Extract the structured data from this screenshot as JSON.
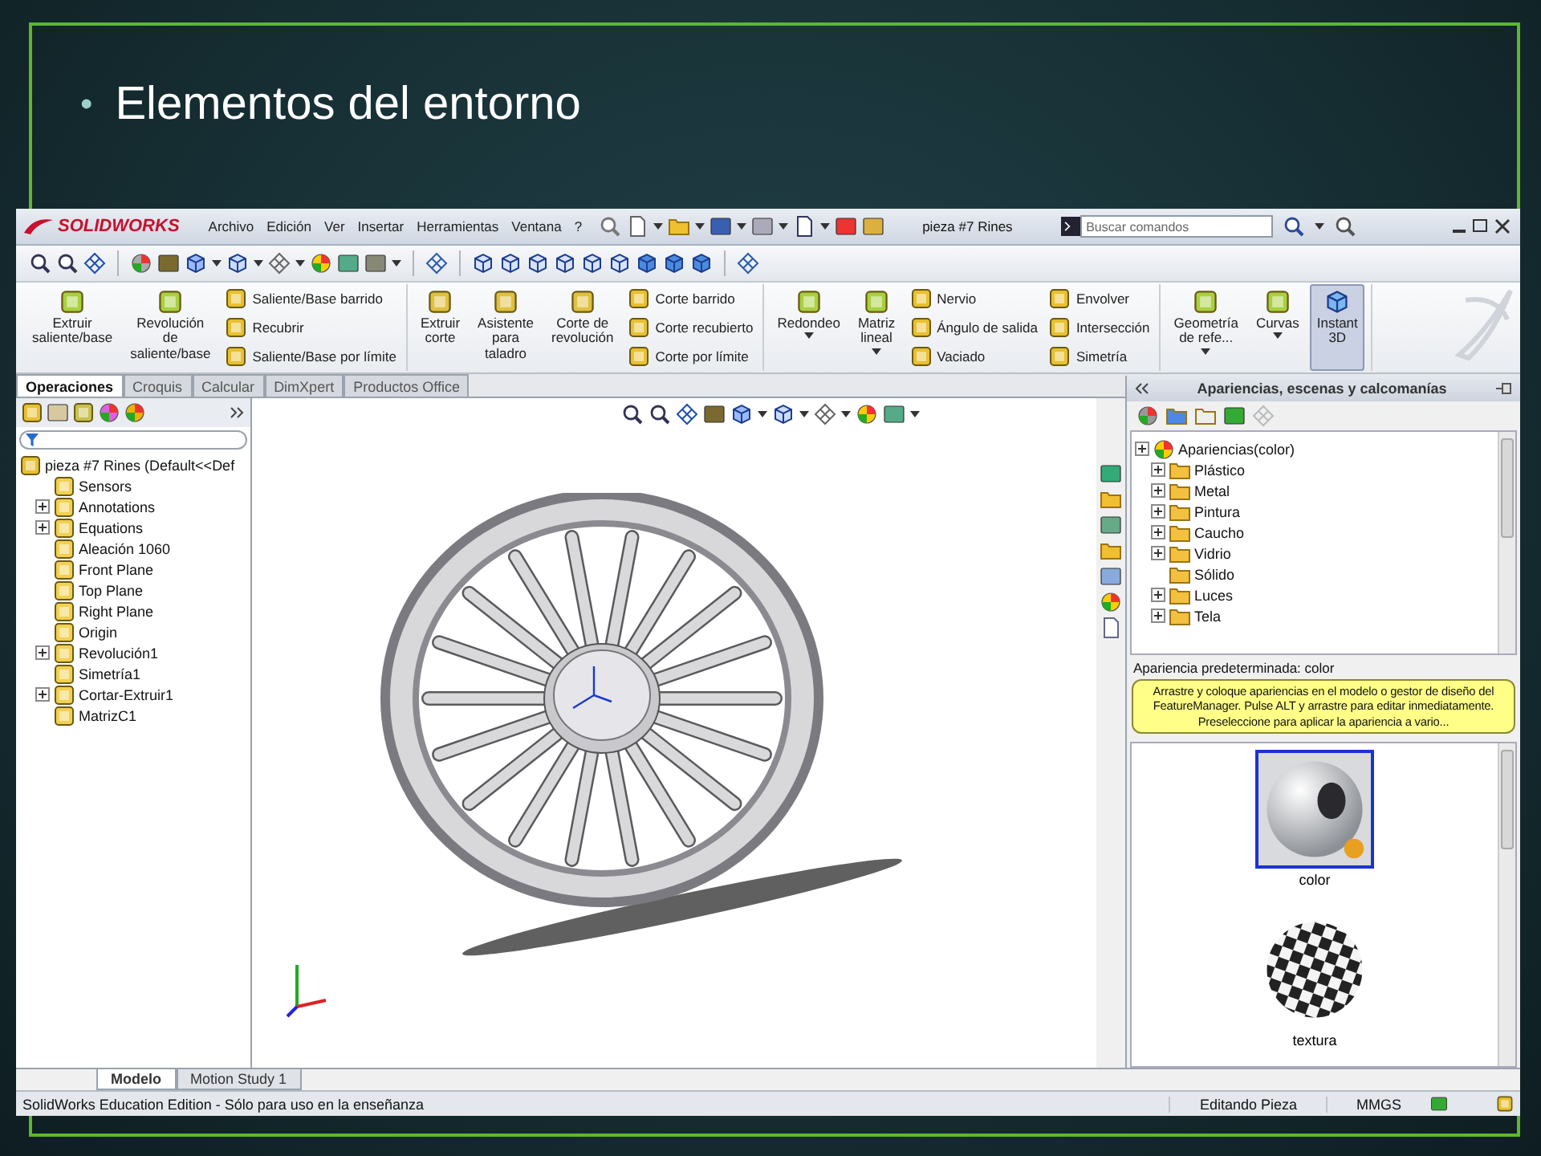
{
  "slide": {
    "bullet": "•",
    "title": "Elementos del entorno"
  },
  "app": {
    "logo": "SOLIDWORKS",
    "menu": [
      "Archivo",
      "Edición",
      "Ver",
      "Insertar",
      "Herramientas",
      "Ventana",
      "?"
    ],
    "document_title": "pieza #7 Rines",
    "search": {
      "placeholder": "Buscar comandos"
    },
    "ribbon": [
      {
        "items": [
          {
            "kind": "large",
            "label": "Extruir\nsaliente/base",
            "dropdown": false,
            "on": false
          },
          {
            "kind": "large",
            "label": "Revolución\nde\nsaliente/base",
            "dropdown": false,
            "on": false
          },
          {
            "kind": "stack",
            "items": [
              "Saliente/Base barrido",
              "Recubrir",
              "Saliente/Base por límite"
            ]
          }
        ]
      },
      {
        "items": [
          {
            "kind": "large",
            "label": "Extruir\ncorte",
            "dropdown": false,
            "on": false
          },
          {
            "kind": "large",
            "label": "Asistente\npara\ntaladro",
            "dropdown": false,
            "on": false
          },
          {
            "kind": "large",
            "label": "Corte de\nrevolución",
            "dropdown": false,
            "on": false
          },
          {
            "kind": "stack",
            "items": [
              "Corte barrido",
              "Corte recubierto",
              "Corte por límite"
            ]
          }
        ]
      },
      {
        "items": [
          {
            "kind": "large",
            "label": "Redondeo",
            "dropdown": true,
            "on": false
          },
          {
            "kind": "large",
            "label": "Matriz\nlineal",
            "dropdown": true,
            "on": false
          },
          {
            "kind": "stack",
            "items": [
              "Nervio",
              "Ángulo de salida",
              "Vaciado"
            ]
          },
          {
            "kind": "stack",
            "items": [
              "Envolver",
              "Intersección",
              "Simetría"
            ]
          }
        ]
      },
      {
        "items": [
          {
            "kind": "large",
            "label": "Geometría\nde refe...",
            "dropdown": true,
            "on": false
          },
          {
            "kind": "large",
            "label": "Curvas",
            "dropdown": true,
            "on": false
          },
          {
            "kind": "large",
            "label": "Instant\n3D",
            "dropdown": false,
            "on": true
          }
        ]
      }
    ],
    "command_tabs": [
      {
        "label": "Operaciones",
        "selected": true
      },
      {
        "label": "Croquis",
        "selected": false
      },
      {
        "label": "Calcular",
        "selected": false
      },
      {
        "label": "DimXpert",
        "selected": false
      },
      {
        "label": "Productos Office",
        "selected": false
      }
    ],
    "feature_tree": {
      "root": "pieza #7 Rines  (Default<<Def",
      "items": [
        {
          "label": "Sensors",
          "expandable": false
        },
        {
          "label": "Annotations",
          "expandable": true
        },
        {
          "label": "Equations",
          "expandable": true
        },
        {
          "label": "Aleación 1060",
          "expandable": false
        },
        {
          "label": "Front Plane",
          "expandable": false
        },
        {
          "label": "Top Plane",
          "expandable": false
        },
        {
          "label": "Right Plane",
          "expandable": false
        },
        {
          "label": "Origin",
          "expandable": false
        },
        {
          "label": "Revolución1",
          "expandable": true
        },
        {
          "label": "Simetría1",
          "expandable": false
        },
        {
          "label": "Cortar-Extruir1",
          "expandable": true
        },
        {
          "label": "MatrizC1",
          "expandable": false
        }
      ]
    },
    "task_pane": {
      "title": "Apariencias, escenas y calcomanías",
      "tree": {
        "root": "Apariencias(color)",
        "items": [
          {
            "label": "Plástico",
            "expandable": true
          },
          {
            "label": "Metal",
            "expandable": true
          },
          {
            "label": "Pintura",
            "expandable": true
          },
          {
            "label": "Caucho",
            "expandable": true
          },
          {
            "label": "Vidrio",
            "expandable": true
          },
          {
            "label": "Sólido",
            "expandable": false
          },
          {
            "label": "Luces",
            "expandable": true
          },
          {
            "label": "Tela",
            "expandable": true
          }
        ]
      },
      "default_appearance": "Apariencia predeterminada: color",
      "hint": "Arrastre y coloque apariencias en el modelo o gestor de diseño del FeatureManager. Pulse ALT y arrastre para editar inmediatamente. Preseleccione para aplicar la apariencia a vario...",
      "swatches": [
        {
          "label": "color",
          "kind": "glossy",
          "selected": true
        },
        {
          "label": "textura",
          "kind": "checker",
          "selected": false
        }
      ]
    },
    "bottom_tabs": [
      {
        "label": "Modelo",
        "selected": true
      },
      {
        "label": "Motion Study 1",
        "selected": false
      }
    ],
    "status_bar": {
      "message": "SolidWorks Education Edition - Sólo para uso en la enseñanza",
      "mode": "Editando Pieza",
      "units": "MMGS"
    }
  }
}
